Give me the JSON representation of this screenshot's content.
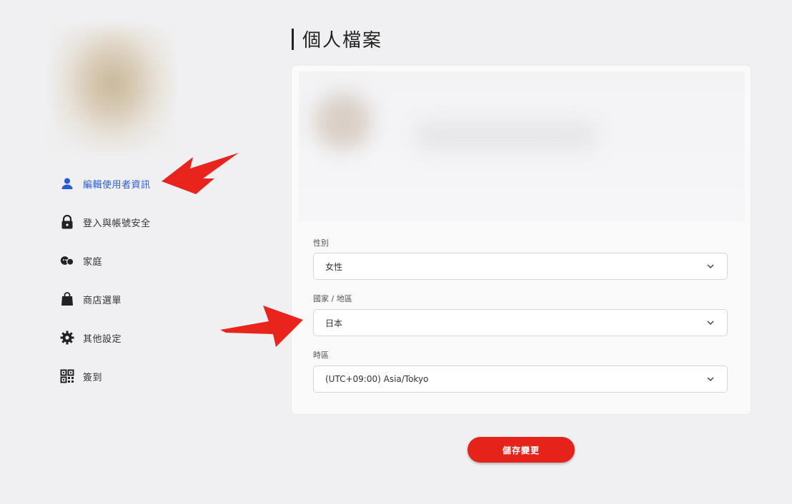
{
  "sidebar": {
    "items": [
      {
        "label": "編輯使用者資訊",
        "icon": "person-icon",
        "active": true
      },
      {
        "label": "登入與帳號安全",
        "icon": "lock-icon"
      },
      {
        "label": "家庭",
        "icon": "family-icon"
      },
      {
        "label": "商店選單",
        "icon": "shopping-bag-icon"
      },
      {
        "label": "其他設定",
        "icon": "gear-icon"
      },
      {
        "label": "簽到",
        "icon": "qr-code-icon"
      }
    ]
  },
  "page": {
    "title": "個人檔案"
  },
  "form": {
    "gender": {
      "label": "性別",
      "value": "女性"
    },
    "region": {
      "label": "國家 / 地區",
      "value": "日本"
    },
    "timezone": {
      "label": "時區",
      "value": "(UTC+09:00) Asia/Tokyo"
    }
  },
  "actions": {
    "save_label": "儲存變更"
  },
  "colors": {
    "accent": "#e5231b",
    "active_link": "#2a5bd7",
    "annotation_arrow": "#e8241c"
  }
}
